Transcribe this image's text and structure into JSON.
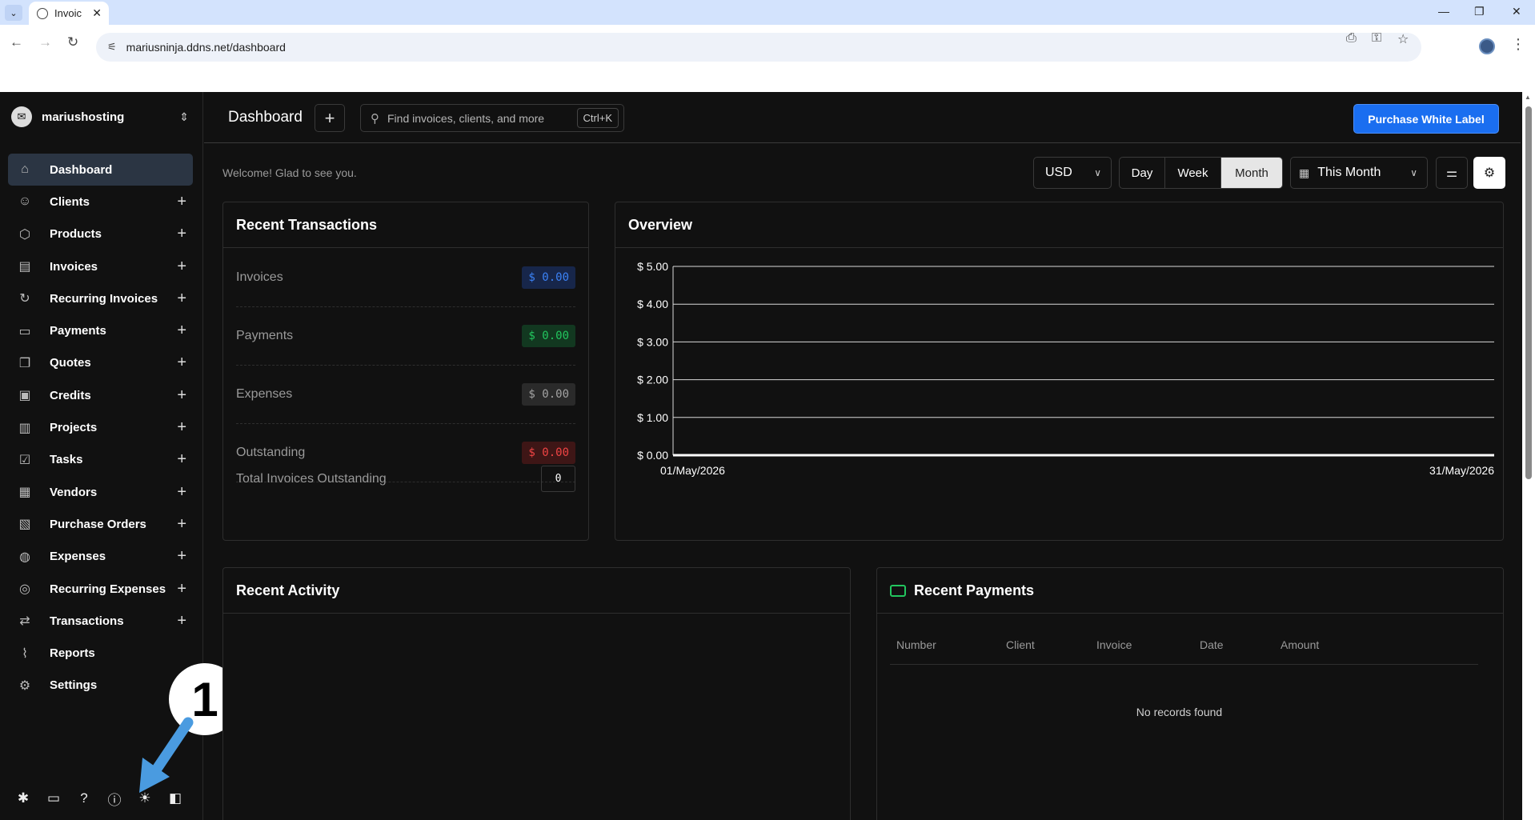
{
  "browser": {
    "tab_title": "Invoic",
    "url": "mariusninja.ddns.net/dashboard"
  },
  "sidebar": {
    "company": "mariushosting",
    "items": [
      {
        "label": "Dashboard",
        "icon": "home-icon",
        "glyph": "⌂",
        "plus": false,
        "active": true
      },
      {
        "label": "Clients",
        "icon": "users-icon",
        "glyph": "☺",
        "plus": true
      },
      {
        "label": "Products",
        "icon": "box-icon",
        "glyph": "⬡",
        "plus": true
      },
      {
        "label": "Invoices",
        "icon": "file-icon",
        "glyph": "▤",
        "plus": true
      },
      {
        "label": "Recurring Invoices",
        "icon": "refresh-icon",
        "glyph": "↻",
        "plus": true
      },
      {
        "label": "Payments",
        "icon": "credit-card-icon",
        "glyph": "▭",
        "plus": true
      },
      {
        "label": "Quotes",
        "icon": "files-icon",
        "glyph": "❐",
        "plus": true
      },
      {
        "label": "Credits",
        "icon": "wallet-icon",
        "glyph": "▣",
        "plus": true
      },
      {
        "label": "Projects",
        "icon": "briefcase-icon",
        "glyph": "▥",
        "plus": true
      },
      {
        "label": "Tasks",
        "icon": "clipboard-icon",
        "glyph": "☑",
        "plus": true
      },
      {
        "label": "Vendors",
        "icon": "building-icon",
        "glyph": "▦",
        "plus": true
      },
      {
        "label": "Purchase Orders",
        "icon": "order-icon",
        "glyph": "▧",
        "plus": true
      },
      {
        "label": "Expenses",
        "icon": "money-bag-icon",
        "glyph": "◍",
        "plus": true
      },
      {
        "label": "Recurring Expenses",
        "icon": "recurring-coin-icon",
        "glyph": "◎",
        "plus": true
      },
      {
        "label": "Transactions",
        "icon": "transfer-icon",
        "glyph": "⇄",
        "plus": true
      },
      {
        "label": "Reports",
        "icon": "chart-line-icon",
        "glyph": "⌇",
        "plus": false
      },
      {
        "label": "Settings",
        "icon": "gear-icon",
        "glyph": "⚙",
        "plus": false
      }
    ],
    "footer_icons": [
      "slack-icon",
      "chat-icon",
      "help-icon",
      "info-icon",
      "theme-sun-icon",
      "collapse-sidebar-icon"
    ]
  },
  "callout": {
    "number": "1"
  },
  "header": {
    "title": "Dashboard",
    "search_placeholder": "Find invoices, clients, and more",
    "search_shortcut": "Ctrl+K",
    "purchase_label": "Purchase White Label"
  },
  "filters": {
    "welcome": "Welcome! Glad to see you.",
    "currency": "USD",
    "periods": [
      "Day",
      "Week",
      "Month"
    ],
    "selected_period": "Month",
    "range": "This Month"
  },
  "recent_transactions": {
    "title": "Recent Transactions",
    "rows": [
      {
        "label": "Invoices",
        "value": "$ 0.00",
        "color": "#3b82f6",
        "bg": "#17264a"
      },
      {
        "label": "Payments",
        "value": "$ 0.00",
        "color": "#22c55e",
        "bg": "#123820"
      },
      {
        "label": "Expenses",
        "value": "$ 0.00",
        "color": "#a3a3a3",
        "bg": "#2a2a2a"
      },
      {
        "label": "Outstanding",
        "value": "$ 0.00",
        "color": "#ef4444",
        "bg": "#3e1616"
      }
    ],
    "total_label": "Total Invoices Outstanding",
    "total_value": "0"
  },
  "overview": {
    "title": "Overview"
  },
  "chart_data": {
    "type": "line",
    "title": "",
    "x": [
      "01/May/2026",
      "31/May/2026"
    ],
    "series": [
      {
        "values": [
          0,
          0
        ]
      }
    ],
    "y_ticks": [
      "$ 0.00",
      "$ 1.00",
      "$ 2.00",
      "$ 3.00",
      "$ 4.00",
      "$ 5.00"
    ],
    "ylim": [
      0,
      5
    ],
    "grid": true
  },
  "recent_activity": {
    "title": "Recent Activity"
  },
  "recent_payments": {
    "title": "Recent Payments",
    "columns": [
      "Number",
      "Client",
      "Invoice",
      "Date",
      "Amount"
    ],
    "empty": "No records found"
  }
}
